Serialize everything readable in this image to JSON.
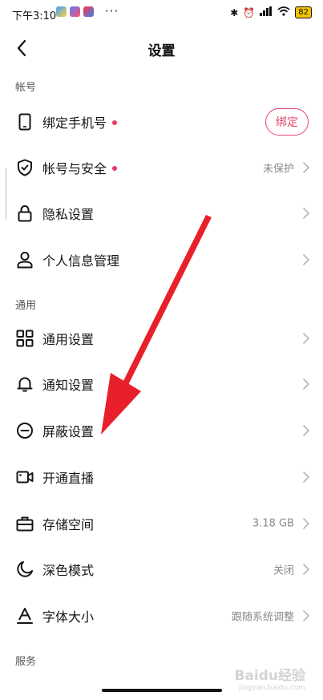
{
  "status_bar": {
    "time": "下午3:10",
    "more": "···",
    "battery": "82"
  },
  "header": {
    "title": "设置"
  },
  "sections": {
    "account": {
      "title": "帐号",
      "bind_phone": {
        "label": "绑定手机号",
        "button": "绑定"
      },
      "account_security": {
        "label": "帐号与安全",
        "value": "未保护"
      },
      "privacy": {
        "label": "隐私设置"
      },
      "personal_info": {
        "label": "个人信息管理"
      }
    },
    "general": {
      "title": "通用",
      "general_settings": {
        "label": "通用设置"
      },
      "notifications": {
        "label": "通知设置"
      },
      "block": {
        "label": "屏蔽设置"
      },
      "live": {
        "label": "开通直播"
      },
      "storage": {
        "label": "存储空间",
        "value": "3.18 GB"
      },
      "dark_mode": {
        "label": "深色模式",
        "value": "关闭"
      },
      "font_size": {
        "label": "字体大小",
        "value": "跟随系统调整"
      }
    },
    "service": {
      "title": "服务"
    }
  },
  "watermark": {
    "line1": "Baidu经验",
    "line2": "jingyan.baidu.com"
  },
  "colors": {
    "accent": "#e24468",
    "arrow": "#e8202b"
  }
}
